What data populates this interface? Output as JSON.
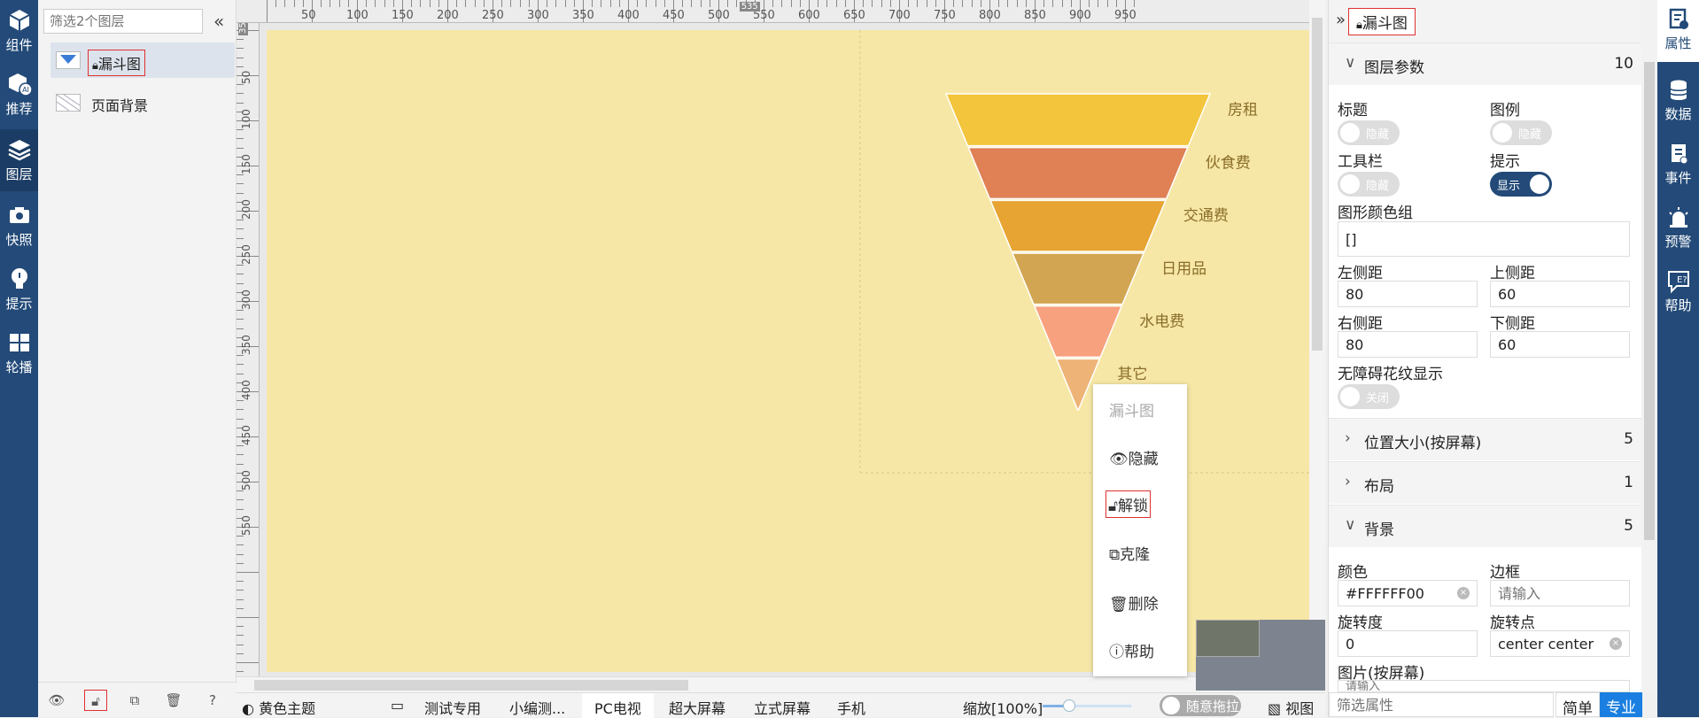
{
  "left_nav": [
    {
      "id": "components",
      "label": "组件",
      "icon": "cube-icon"
    },
    {
      "id": "recommend",
      "label": "推荐",
      "icon": "ai-cube-icon"
    },
    {
      "id": "layers",
      "label": "图层",
      "icon": "layers-icon"
    },
    {
      "id": "snapshot",
      "label": "快照",
      "icon": "camera-icon"
    },
    {
      "id": "tips",
      "label": "提示",
      "icon": "bulb-icon"
    },
    {
      "id": "carousel",
      "label": "轮播",
      "icon": "windows-icon"
    }
  ],
  "layers_panel": {
    "filter_placeholder": "筛选2个图层",
    "items": [
      {
        "name": "漏斗图",
        "locked": true,
        "thumb": "funnel-thumb-icon"
      },
      {
        "name": "页面背景",
        "locked": false,
        "thumb": "background-thumb-icon"
      }
    ]
  },
  "ruler": {
    "x_ticks": [
      "50",
      "100",
      "150",
      "200",
      "250",
      "300",
      "350",
      "400",
      "450",
      "500",
      "550",
      "600",
      "650",
      "700",
      "750",
      "800",
      "850",
      "900",
      "950"
    ],
    "x_marker": "535",
    "y_marker": "35",
    "y_ticks": [
      "50",
      "100",
      "150",
      "200",
      "250",
      "300",
      "350",
      "400",
      "450",
      "500",
      "550"
    ]
  },
  "chart_data": {
    "type": "funnel",
    "categories": [
      "房租",
      "伙食费",
      "交通费",
      "日用品",
      "水电费",
      "其它"
    ],
    "colors": [
      "#f3c53c",
      "#df8055",
      "#e7a432",
      "#d2a552",
      "#f8a17e",
      "#eeb377"
    ],
    "sort": "descending"
  },
  "context_menu": {
    "title": "漏斗图",
    "items": [
      {
        "label": "隐藏",
        "icon": "eye-hidden-icon"
      },
      {
        "label": "解锁",
        "icon": "unlock-icon"
      },
      {
        "label": "克隆",
        "icon": "clone-icon"
      },
      {
        "label": "删除",
        "icon": "trash-icon"
      },
      {
        "label": "帮助",
        "icon": "help-icon"
      }
    ]
  },
  "bottom_bar": {
    "theme": "黄色主题",
    "tabs": [
      "测试专用",
      "小编测...",
      "PC电视",
      "超大屏幕",
      "立式屏幕",
      "手机"
    ],
    "active_tab": "PC电视",
    "zoom_label": "缩放[100%]",
    "zoom_fraction": 0.3,
    "drag_label": "随意拖拉",
    "view_label": "视图"
  },
  "right_panel": {
    "title": "漏斗图",
    "sections": {
      "layer_params": {
        "label": "图层参数",
        "count": "10"
      },
      "position_size": {
        "label": "位置大小(按屏幕)",
        "count": "5"
      },
      "layout": {
        "label": "布局",
        "count": "1"
      },
      "background": {
        "label": "背景",
        "count": "5"
      }
    },
    "fields": {
      "title": {
        "label": "标题",
        "toggle": "隐藏",
        "on": false
      },
      "legend": {
        "label": "图例",
        "toggle": "隐藏",
        "on": false
      },
      "toolbar": {
        "label": "工具栏",
        "toggle": "隐藏",
        "on": false
      },
      "tooltip": {
        "label": "提示",
        "toggle": "显示",
        "on": true
      },
      "color_group": {
        "label": "图形颜色组",
        "value": "[]"
      },
      "left_margin": {
        "label": "左侧距",
        "value": "80"
      },
      "top_margin": {
        "label": "上侧距",
        "value": "60"
      },
      "right_margin": {
        "label": "右侧距",
        "value": "80"
      },
      "bottom_margin": {
        "label": "下侧距",
        "value": "60"
      },
      "aria_decal": {
        "label": "无障碍花纹显示",
        "toggle": "关闭",
        "on": false
      },
      "bg_color": {
        "label": "颜色",
        "value": "#FFFFFF00"
      },
      "border": {
        "label": "边框",
        "placeholder": "请输入"
      },
      "rotation": {
        "label": "旋转度",
        "value": "0"
      },
      "rotation_origin": {
        "label": "旋转点",
        "value": "center center"
      },
      "image": {
        "label": "图片(按屏幕)",
        "placeholder": "请输入"
      }
    },
    "filter_placeholder": "筛选属性",
    "mode_simple": "简单",
    "mode_pro": "专业"
  },
  "right_nav": [
    {
      "id": "props",
      "label": "属性",
      "icon": "properties-icon"
    },
    {
      "id": "data",
      "label": "数据",
      "icon": "database-icon"
    },
    {
      "id": "events",
      "label": "事件",
      "icon": "event-icon"
    },
    {
      "id": "alerts",
      "label": "预警",
      "icon": "alarm-icon"
    },
    {
      "id": "help",
      "label": "帮助",
      "icon": "help-chat-icon"
    }
  ]
}
